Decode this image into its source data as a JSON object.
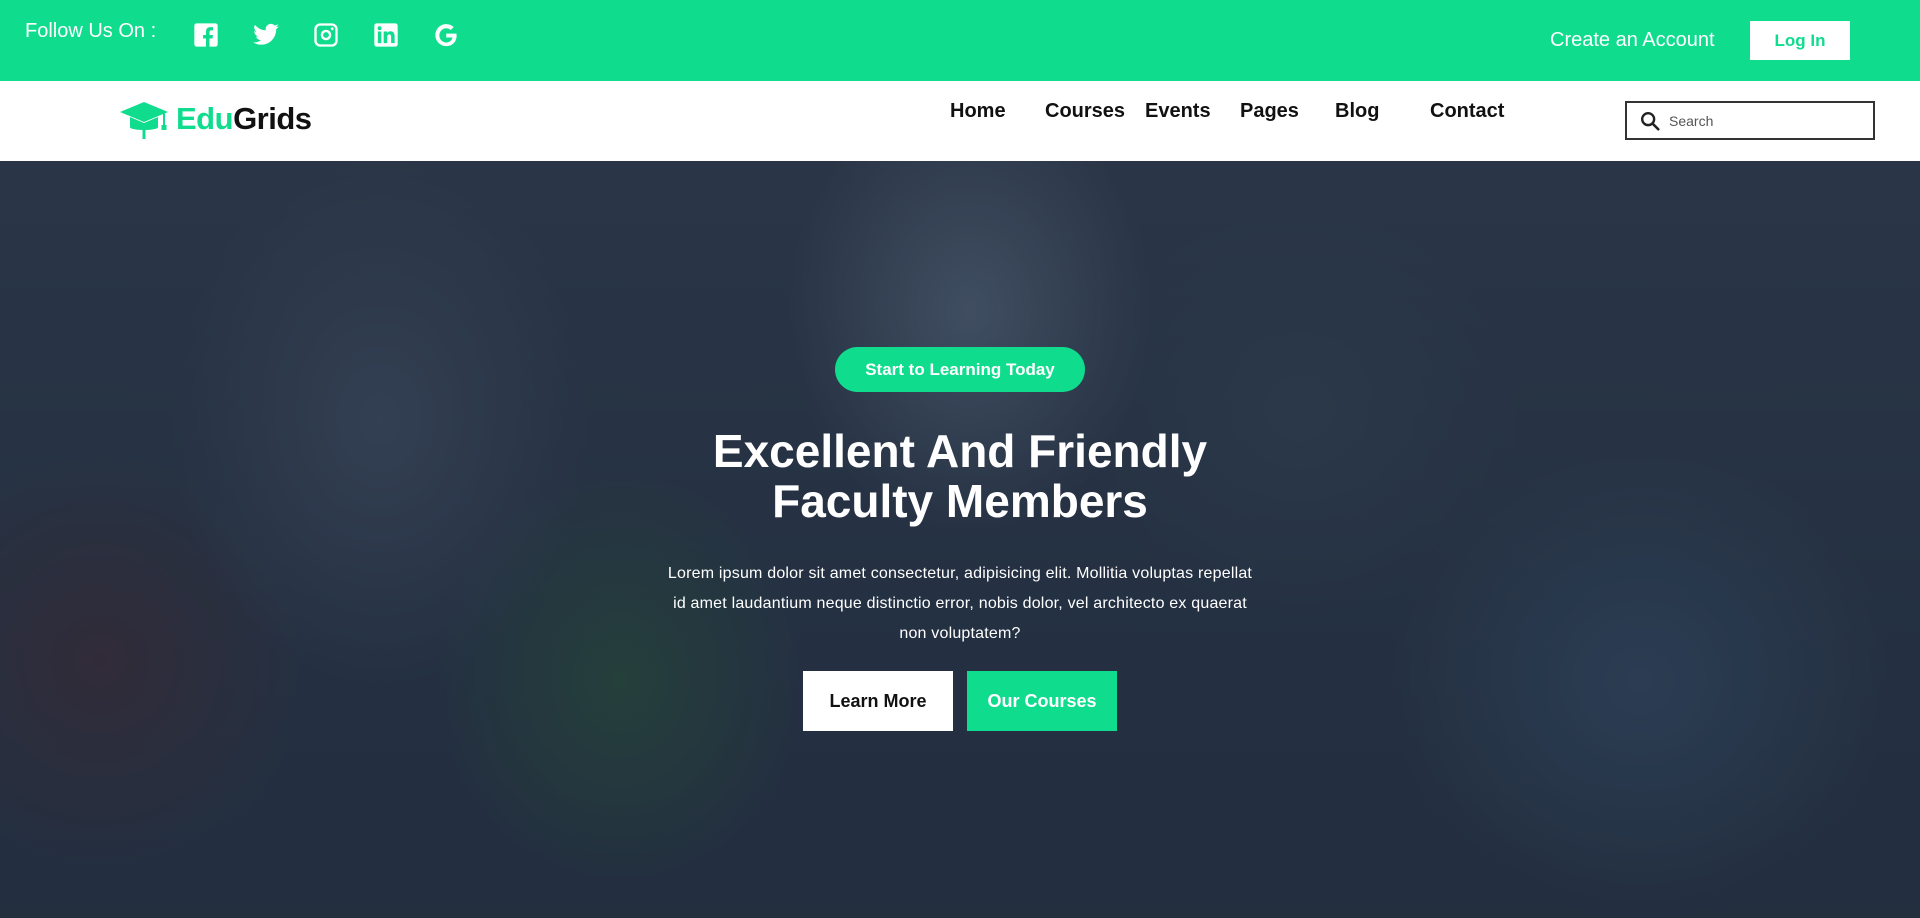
{
  "colors": {
    "accent": "#10dc8e",
    "dark": "#111111",
    "white": "#ffffff"
  },
  "topbar": {
    "follow_label": "Follow Us On :",
    "socials": [
      "facebook-icon",
      "twitter-icon",
      "instagram-icon",
      "linkedin-icon",
      "google-icon"
    ],
    "create_account": "Create an Account",
    "login": "Log In"
  },
  "navbar": {
    "logo_part1": "Edu",
    "logo_part2": "Grids",
    "items": [
      "Home",
      "Courses",
      "Events",
      "Pages",
      "Blog",
      "Contact"
    ],
    "search_placeholder": "Search"
  },
  "hero": {
    "pill": "Start to Learning Today",
    "title_line1": "Excellent And Friendly",
    "title_line2": "Faculty Members",
    "text": "Lorem ipsum dolor sit amet consectetur, adipisicing elit. Mollitia voluptas repellat id amet laudantium neque distinctio error, nobis dolor, vel architecto ex quaerat non voluptatem?",
    "btn_learn": "Learn More",
    "btn_courses": "Our Courses"
  }
}
